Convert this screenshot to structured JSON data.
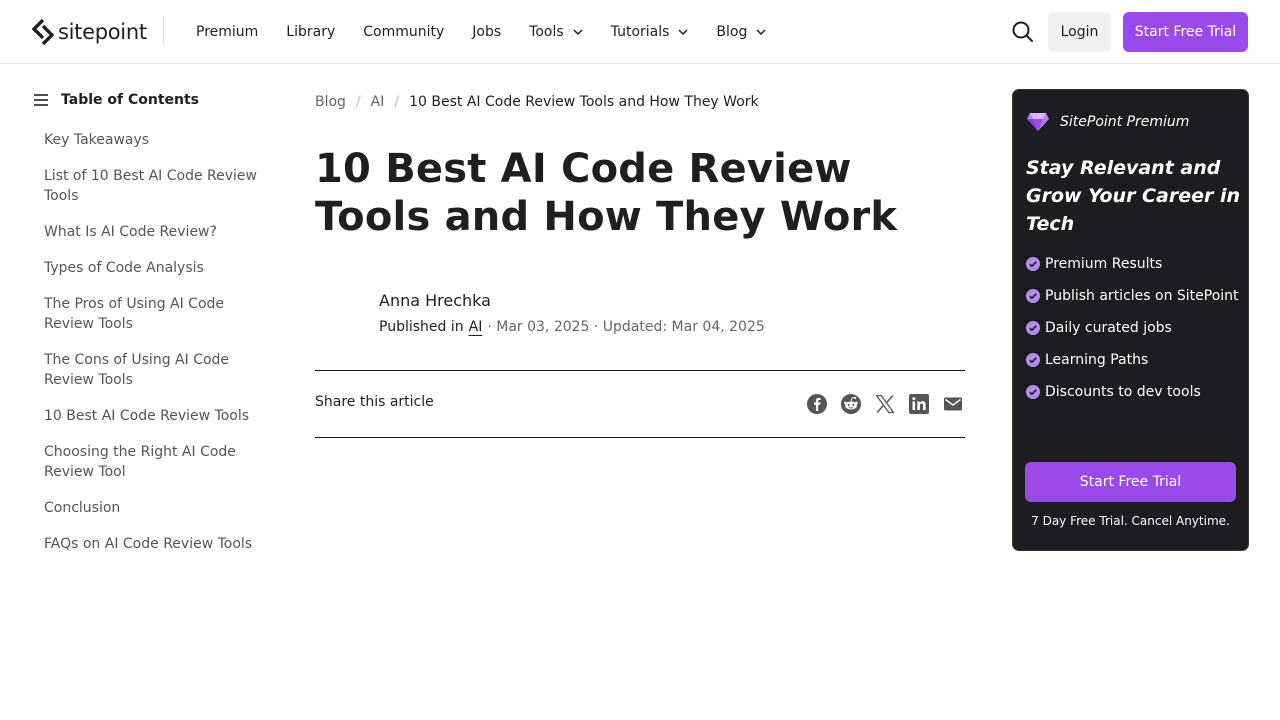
{
  "header": {
    "logo_text": "sitepoint",
    "nav": [
      {
        "label": "Premium",
        "dropdown": false
      },
      {
        "label": "Library",
        "dropdown": false
      },
      {
        "label": "Community",
        "dropdown": false
      },
      {
        "label": "Jobs",
        "dropdown": false
      },
      {
        "label": "Tools",
        "dropdown": true
      },
      {
        "label": "Tutorials",
        "dropdown": true
      },
      {
        "label": "Blog",
        "dropdown": true
      }
    ],
    "login_label": "Login",
    "trial_label": "Start Free Trial"
  },
  "toc": {
    "title": "Table of Contents",
    "items": [
      "Key Takeaways",
      "List of 10 Best AI Code Review Tools",
      "What Is AI Code Review?",
      "Types of Code Analysis",
      "The Pros of Using AI Code Review Tools",
      "The Cons of Using AI Code Review Tools",
      "10 Best AI Code Review Tools",
      "Choosing the Right AI Code Review Tool",
      "Conclusion",
      "FAQs on AI Code Review Tools"
    ]
  },
  "breadcrumb": {
    "items": [
      "Blog",
      "AI"
    ],
    "current": "10 Best AI Code Review Tools and How They Work"
  },
  "article": {
    "title": "10 Best AI Code Review Tools and How They Work",
    "author": "Anna Hrechka",
    "published_prefix": "Published in",
    "category": "AI",
    "dates": "· Mar 03, 2025 · Updated: Mar 04, 2025"
  },
  "share": {
    "label": "Share this article",
    "icons": [
      "facebook-icon",
      "reddit-icon",
      "x-icon",
      "linkedin-icon",
      "email-icon"
    ]
  },
  "premium": {
    "brand": "SitePoint Premium",
    "headline": "Stay Relevant and Grow Your Career in Tech",
    "features": [
      "Premium Results",
      "Publish articles on SitePoint",
      "Daily curated jobs",
      "Learning Paths",
      "Discounts to dev tools"
    ],
    "cta_label": "Start Free Trial",
    "note": "7 Day Free Trial. Cancel Anytime."
  },
  "colors": {
    "accent": "#9a4ae8",
    "card_bg": "#1d1c21",
    "check": "#b58cf0"
  }
}
